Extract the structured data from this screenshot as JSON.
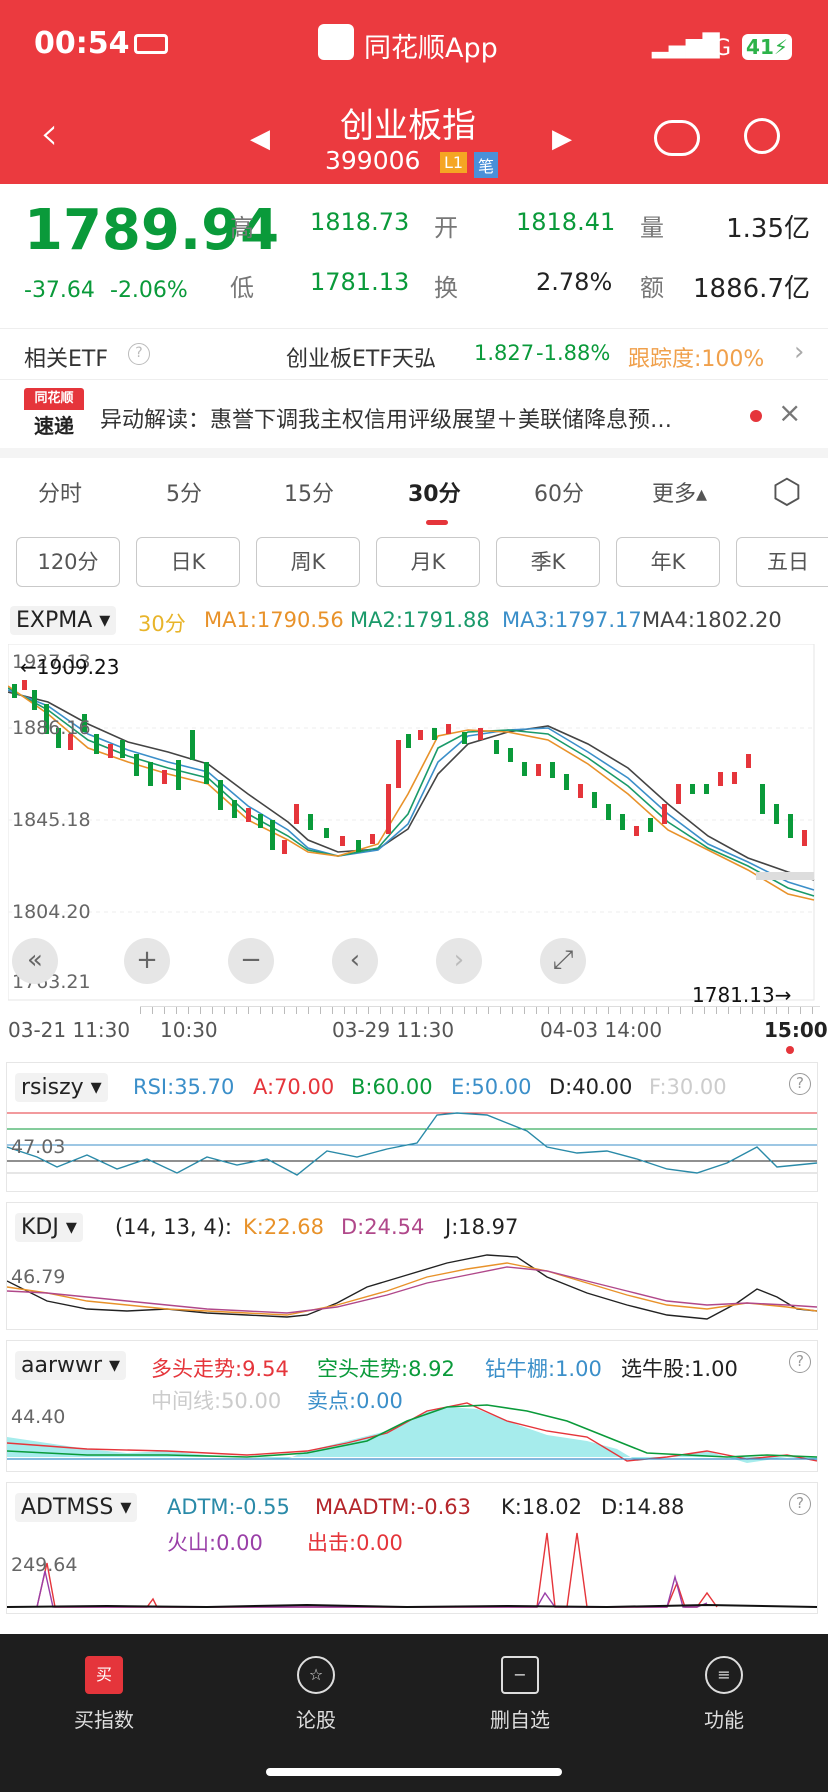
{
  "status_bar": {
    "time": "00:54",
    "app": "同花顺App",
    "network": "4G",
    "battery": "41"
  },
  "header": {
    "title": "创业板指",
    "code": "399006",
    "badge_l1": "L1",
    "badge_pen": "笔"
  },
  "quote": {
    "price": "1789.94",
    "change": "-37.64",
    "change_pct": "-2.06%",
    "high_label": "高",
    "high": "1818.73",
    "open_label": "开",
    "open": "1818.41",
    "vol_label": "量",
    "vol": "1.35亿",
    "low_label": "低",
    "low": "1781.13",
    "turnover_label": "换",
    "turnover": "2.78%",
    "amount_label": "额",
    "amount": "1886.7亿"
  },
  "etf": {
    "label": "相关ETF",
    "name": "创业板ETF天弘",
    "price": "1.827",
    "chg": "-1.88%",
    "track": "跟踪度:100%"
  },
  "news": {
    "logo_top": "同花顺",
    "logo_bottom": "速递",
    "text": "异动解读：惠誉下调我主权信用评级展望＋美联储降息预…"
  },
  "tabs": [
    "分时",
    "5分",
    "15分",
    "30分",
    "60分",
    "更多▴"
  ],
  "period_pills": [
    "120分",
    "日K",
    "周K",
    "月K",
    "季K",
    "年K",
    "五日"
  ],
  "main_chart": {
    "indicator": "EXPMA",
    "period": "30分",
    "ma1": "MA1:1790.56",
    "ma2": "MA2:1791.88",
    "ma3": "MA3:1797.17",
    "ma4": "MA4:1802.20",
    "y_labels": [
      "1927.13",
      "1886.16",
      "1845.18",
      "1804.20",
      "1763.21"
    ],
    "high_marker": "←1909.23",
    "low_marker": "1781.13→",
    "x_labels": [
      "03-21 11:30",
      "10:30",
      "03-29 11:30",
      "04-03 14:00",
      "15:00"
    ]
  },
  "rsi": {
    "indicator": "rsiszy",
    "rsi": "RSI:35.70",
    "a": "A:70.00",
    "b": "B:60.00",
    "e": "E:50.00",
    "d": "D:40.00",
    "f": "F:30.00",
    "y": "47.03"
  },
  "kdj": {
    "indicator": "KDJ",
    "params": "(14, 13, 4):",
    "k": "K:22.68",
    "d": "D:24.54",
    "j": "J:18.97",
    "y": "46.79"
  },
  "aarw": {
    "indicator": "aarwwr",
    "bull": "多头走势:9.54",
    "bear": "空头走势:8.92",
    "drill": "钻牛棚:1.00",
    "pick": "选牛股:1.00",
    "mid": "中间线:50.00",
    "sell": "卖点:0.00",
    "y": "44.40"
  },
  "adtm": {
    "indicator": "ADTMSS",
    "adtm": "ADTM:-0.55",
    "maadtm": "MAADTM:-0.63",
    "k": "K:18.02",
    "d": "D:14.88",
    "volcano": "火山:0.00",
    "strike": "出击:0.00",
    "y": "249.64"
  },
  "tabbar": [
    "买指数",
    "论股",
    "删自选",
    "功能"
  ],
  "colors": {
    "header": "#eb3a3f",
    "up": "#e5353b",
    "down": "#0a9a3a",
    "ma1": "#e8922a",
    "ma2": "#1a9a6a",
    "ma3": "#3b8fc9",
    "ma4": "#444444"
  }
}
